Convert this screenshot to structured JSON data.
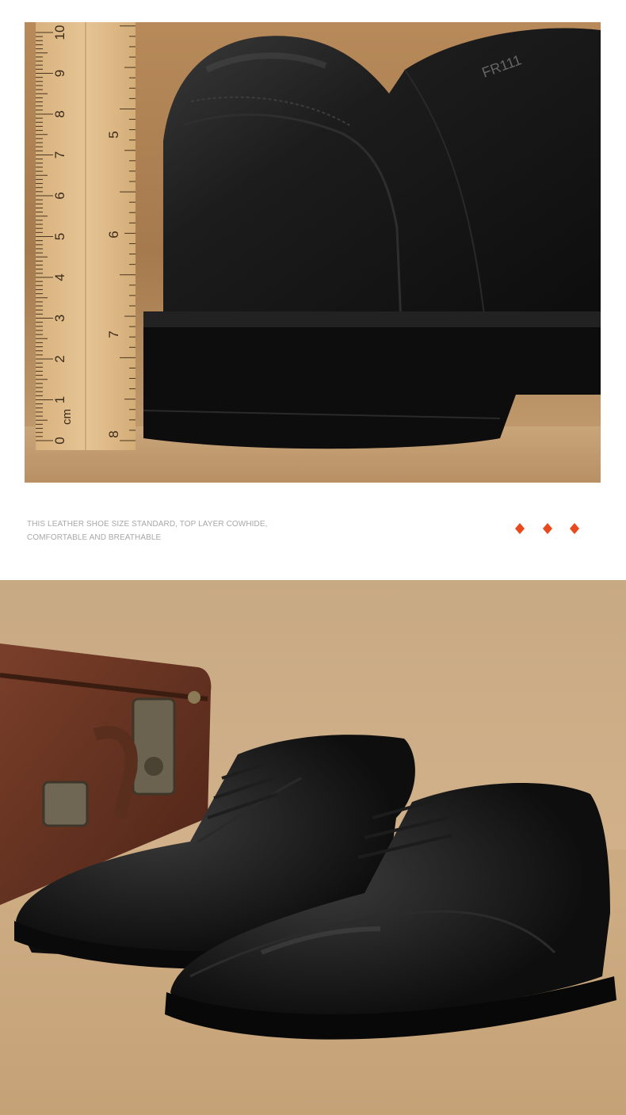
{
  "caption": {
    "line1": "THIS LEATHER SHOE SIZE STANDARD, TOP LAYER COWHIDE,",
    "line2": "COMFORTABLE AND BREATHABLE"
  },
  "ruler": {
    "unit_label": "cm",
    "numbers": [
      "0",
      "1",
      "2",
      "3",
      "4",
      "5",
      "6",
      "7",
      "8",
      "9",
      "10"
    ],
    "inch_numbers": [
      "8",
      "7",
      "6",
      "5"
    ]
  },
  "shoe_label": "FR111",
  "colors": {
    "accent": "#e8491d",
    "caption_text": "#a8a8a8",
    "shoe": "#151515",
    "burlap": "#c9a57a",
    "ruler": "#e0bc8a"
  },
  "images": {
    "top_photo": "shoe-heel-with-ruler",
    "bottom_photo": "pair-of-black-derby-shoes-with-vintage-suitcase"
  }
}
